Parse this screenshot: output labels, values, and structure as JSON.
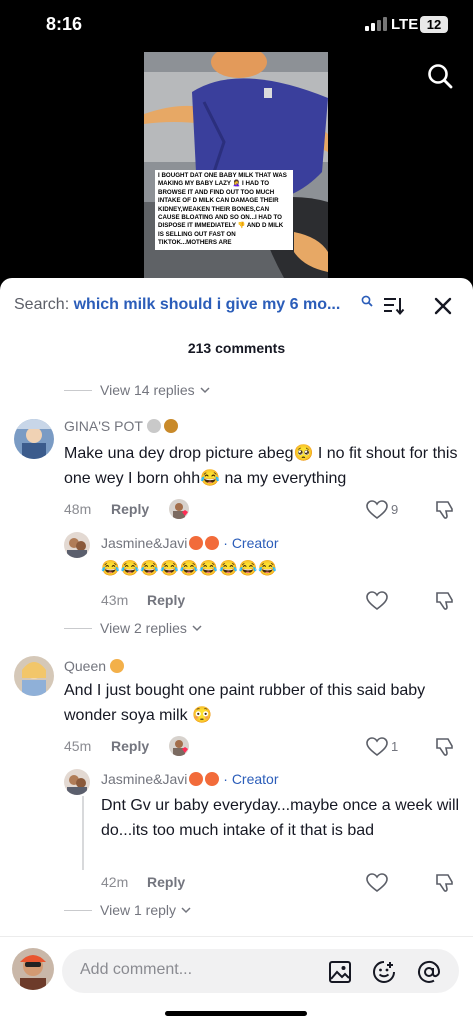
{
  "status_bar": {
    "time": "8:16",
    "network": "LTE",
    "battery": "12"
  },
  "video": {
    "caption": "I bought dat one baby milk that was making my baby lazy 🤦‍♀️ I had to browse it and find out too much intake of d milk can damage their kidney,weaken their bones,can cause bloating and so on...I had to dispose it immediately 👎 and d milk is selling out fast on TikTok...mothers are"
  },
  "search": {
    "prefix": "Search: ",
    "query": "which milk should i give my 6 mo..."
  },
  "comments_count": "213 comments",
  "thread_top": {
    "view_replies": "View 14 replies"
  },
  "comments": [
    {
      "author": "GINA'S POT",
      "text": "Make una dey drop picture abeg🥺 I no fit shout for this one wey I born ohh😂 na my everything",
      "time": "48m",
      "reply_label": "Reply",
      "likes": "9",
      "reply": {
        "author": "Jasmine&Javi",
        "creator_label": "· Creator",
        "text": "😂😂😂😂😂😂😂😂😂",
        "time": "43m",
        "reply_label": "Reply"
      },
      "view_replies": "View 2 replies"
    },
    {
      "author": "Queen",
      "text": "And I just bought one paint rubber of this said baby wonder soya milk 😳",
      "time": "45m",
      "reply_label": "Reply",
      "likes": "1",
      "reply": {
        "author": "Jasmine&Javi",
        "creator_label": "· Creator",
        "text": "Dnt Gv ur baby everyday...maybe once a week will do...its too much intake of it that is bad",
        "time": "42m",
        "reply_label": "Reply"
      },
      "view_replies": "View 1 reply"
    }
  ],
  "bottom_bar": {
    "placeholder": "Add comment..."
  },
  "colors": {
    "link_blue": "#2b5db9",
    "muted": "#73757e",
    "heart_red": "#fe2c55"
  }
}
